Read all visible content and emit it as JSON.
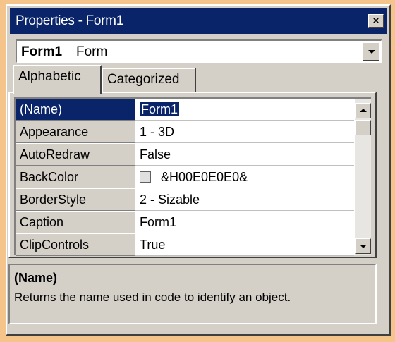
{
  "window": {
    "title": "Properties - Form1",
    "close_glyph": "×"
  },
  "object_selector": {
    "name": "Form1",
    "type": "Form"
  },
  "tabs": [
    {
      "label": "Alphabetic",
      "active": true
    },
    {
      "label": "Categorized",
      "active": false
    }
  ],
  "properties": [
    {
      "name": "(Name)",
      "value": "Form1",
      "selected": true
    },
    {
      "name": "Appearance",
      "value": "1 - 3D"
    },
    {
      "name": "AutoRedraw",
      "value": "False"
    },
    {
      "name": "BackColor",
      "value": "&H00E0E0E0&",
      "swatch_color": "#e0e0e0"
    },
    {
      "name": "BorderStyle",
      "value": "2 - Sizable"
    },
    {
      "name": "Caption",
      "value": "Form1"
    },
    {
      "name": "ClipControls",
      "value": "True"
    }
  ],
  "description": {
    "title": "(Name)",
    "text": "Returns the name used in code to identify an object."
  },
  "colors": {
    "titlebar": "#0a246a",
    "face": "#d4d0c8",
    "selection": "#0a246a"
  }
}
